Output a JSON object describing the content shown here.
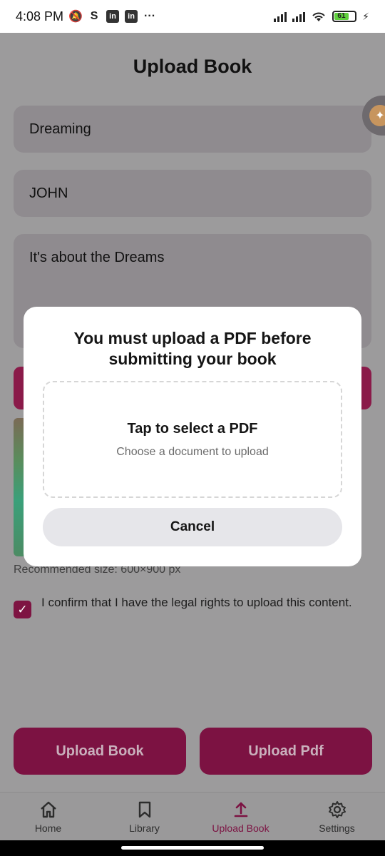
{
  "status_bar": {
    "time": "4:08 PM",
    "icons_left": [
      "muted-bell-icon",
      "s-icon",
      "linkedin-icon",
      "linkedin-icon",
      "more-icon"
    ],
    "battery_level": "61",
    "more_label": "···"
  },
  "page": {
    "title": "Upload Book",
    "fields": {
      "title_value": "Dreaming",
      "author_value": "JOHN",
      "description_value": "It's about the Dreams"
    },
    "recommended_size": "Recommended size: 600×900 px",
    "confirm_text": "I confirm that I have the legal rights to upload this content.",
    "confirm_checked": true,
    "buttons": {
      "upload_book": "Upload Book",
      "upload_pdf": "Upload Pdf"
    }
  },
  "modal": {
    "title": "You must upload a PDF before submitting your book",
    "drop_title": "Tap to select a PDF",
    "drop_subtitle": "Choose a document to upload",
    "cancel_label": "Cancel"
  },
  "bottom_nav": {
    "items": [
      {
        "label": "Home",
        "icon": "home-icon"
      },
      {
        "label": "Library",
        "icon": "bookmark-icon"
      },
      {
        "label": "Upload Book",
        "icon": "upload-icon",
        "active": true
      },
      {
        "label": "Settings",
        "icon": "gear-icon"
      }
    ]
  },
  "colors": {
    "accent": "#7c1242",
    "overlay": "#9c9b9c",
    "modal_bg": "#ffffff"
  }
}
